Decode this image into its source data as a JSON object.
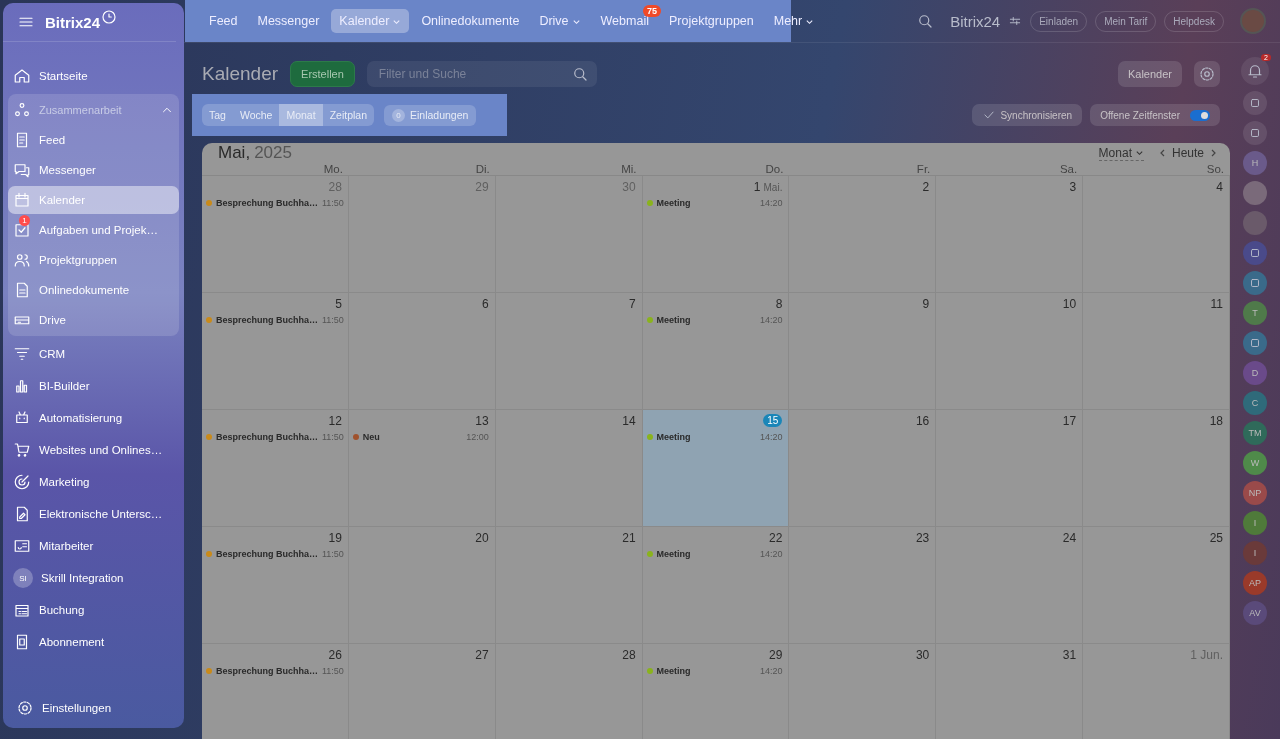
{
  "sidebar": {
    "logo": "Bitrix24",
    "items": [
      {
        "label": "Startseite",
        "kind": "link",
        "selected": false
      },
      {
        "label": "Zusammenarbeit",
        "kind": "group",
        "expanded": true,
        "children": [
          {
            "label": "Feed",
            "selected": false
          },
          {
            "label": "Messenger",
            "selected": false
          },
          {
            "label": "Kalender",
            "selected": true
          },
          {
            "label": "Aufgaben und Projek…",
            "selected": false,
            "badge": "1"
          },
          {
            "label": "Projektgruppen",
            "selected": false
          },
          {
            "label": "Onlinedokumente",
            "selected": false
          },
          {
            "label": "Drive",
            "selected": false
          }
        ]
      },
      {
        "label": "CRM",
        "kind": "link",
        "selected": false
      },
      {
        "label": "BI-Builder",
        "kind": "link",
        "selected": false
      },
      {
        "label": "Automatisierung",
        "kind": "link",
        "selected": false
      },
      {
        "label": "Websites und Onlines…",
        "kind": "link",
        "selected": false
      },
      {
        "label": "Marketing",
        "kind": "link",
        "selected": false
      },
      {
        "label": "Elektronische Untersc…",
        "kind": "link",
        "selected": false
      },
      {
        "label": "Mitarbeiter",
        "kind": "link",
        "selected": false
      },
      {
        "label": "Skrill Integration",
        "kind": "avatar",
        "initials": "SI",
        "selected": false
      },
      {
        "label": "Buchung",
        "kind": "link",
        "selected": false
      },
      {
        "label": "Abonnement",
        "kind": "link",
        "selected": false
      }
    ],
    "settings": "Einstellungen"
  },
  "topnav": {
    "items": [
      {
        "label": "Feed",
        "selected": false,
        "dropdown": false
      },
      {
        "label": "Messenger",
        "selected": false,
        "dropdown": false
      },
      {
        "label": "Kalender",
        "selected": true,
        "dropdown": true
      },
      {
        "label": "Onlinedokumente",
        "selected": false,
        "dropdown": false
      },
      {
        "label": "Drive",
        "selected": false,
        "dropdown": true
      },
      {
        "label": "Webmail",
        "selected": false,
        "dropdown": false,
        "badge": "75"
      },
      {
        "label": "Projektgruppen",
        "selected": false,
        "dropdown": false
      },
      {
        "label": "Mehr",
        "selected": false,
        "dropdown": true
      }
    ],
    "portal": "Bitrix24",
    "buttons": [
      "Einladen",
      "Mein Tarif",
      "Helpdesk"
    ]
  },
  "header": {
    "title": "Kalender",
    "create": "Erstellen",
    "search": {
      "placeholder": "Filter und Suche"
    },
    "calendar_button": "Kalender"
  },
  "views": [
    {
      "label": "Tag",
      "selected": false
    },
    {
      "label": "Woche",
      "selected": false
    },
    {
      "label": "Monat",
      "selected": true
    },
    {
      "label": "Zeitplan",
      "selected": false
    }
  ],
  "invitations": {
    "count": "0",
    "label": "Einladungen"
  },
  "sync": "Synchronisieren",
  "open_slots": {
    "label": "Offene Zeitfenster",
    "on": true
  },
  "calendar": {
    "month": "Mai,",
    "year": "2025",
    "mode": "Monat",
    "today": "Heute",
    "weekdays": [
      "Mo.",
      "Di.",
      "Mi.",
      "Do.",
      "Fr.",
      "Sa.",
      "So."
    ],
    "weeks": [
      [
        {
          "day": "28",
          "muted": true,
          "today": false,
          "events": [
            {
              "title": "Besprechung Buchha…",
              "time": "11:50",
              "color": "#c98a1a"
            }
          ]
        },
        {
          "day": "29",
          "muted": true,
          "today": false
        },
        {
          "day": "30",
          "muted": true,
          "today": false
        },
        {
          "day": "1",
          "month": "Mai.",
          "muted": false,
          "today": false,
          "events": [
            {
              "title": "Meeting",
              "time": "14:20",
              "color": "#8ab31c"
            }
          ]
        },
        {
          "day": "2",
          "muted": false,
          "today": false
        },
        {
          "day": "3",
          "muted": false,
          "today": false
        },
        {
          "day": "4",
          "muted": false,
          "today": false
        }
      ],
      [
        {
          "day": "5",
          "muted": false,
          "today": false,
          "events": [
            {
              "title": "Besprechung Buchha…",
              "time": "11:50",
              "color": "#c98a1a"
            }
          ]
        },
        {
          "day": "6",
          "muted": false,
          "today": false
        },
        {
          "day": "7",
          "muted": false,
          "today": false
        },
        {
          "day": "8",
          "muted": false,
          "today": false,
          "events": [
            {
              "title": "Meeting",
              "time": "14:20",
              "color": "#8ab31c"
            }
          ]
        },
        {
          "day": "9",
          "muted": false,
          "today": false
        },
        {
          "day": "10",
          "muted": false,
          "today": false
        },
        {
          "day": "11",
          "muted": false,
          "today": false
        }
      ],
      [
        {
          "day": "12",
          "muted": false,
          "today": false,
          "events": [
            {
              "title": "Besprechung Buchha…",
              "time": "11:50",
              "color": "#c98a1a"
            }
          ]
        },
        {
          "day": "13",
          "muted": false,
          "today": false,
          "events": [
            {
              "title": "Neu",
              "time": "12:00",
              "color": "#a0522d"
            }
          ]
        },
        {
          "day": "14",
          "muted": false,
          "today": false
        },
        {
          "day": "15",
          "muted": false,
          "today": true,
          "events": [
            {
              "title": "Meeting",
              "time": "14:20",
              "color": "#8ab31c"
            }
          ]
        },
        {
          "day": "16",
          "muted": false,
          "today": false
        },
        {
          "day": "17",
          "muted": false,
          "today": false
        },
        {
          "day": "18",
          "muted": false,
          "today": false
        }
      ],
      [
        {
          "day": "19",
          "muted": false,
          "today": false,
          "events": [
            {
              "title": "Besprechung Buchha…",
              "time": "11:50",
              "color": "#c98a1a"
            }
          ]
        },
        {
          "day": "20",
          "muted": false,
          "today": false
        },
        {
          "day": "21",
          "muted": false,
          "today": false
        },
        {
          "day": "22",
          "muted": false,
          "today": false,
          "events": [
            {
              "title": "Meeting",
              "time": "14:20",
              "color": "#8ab31c"
            }
          ]
        },
        {
          "day": "23",
          "muted": false,
          "today": false
        },
        {
          "day": "24",
          "muted": false,
          "today": false
        },
        {
          "day": "25",
          "muted": false,
          "today": false
        }
      ],
      [
        {
          "day": "26",
          "muted": false,
          "today": false,
          "events": [
            {
              "title": "Besprechung Buchha…",
              "time": "11:50",
              "color": "#c98a1a"
            }
          ]
        },
        {
          "day": "27",
          "muted": false,
          "today": false
        },
        {
          "day": "28",
          "muted": false,
          "today": false
        },
        {
          "day": "29",
          "muted": false,
          "today": false,
          "events": [
            {
              "title": "Meeting",
              "time": "14:20",
              "color": "#8ab31c"
            }
          ]
        },
        {
          "day": "30",
          "muted": false,
          "today": false
        },
        {
          "day": "31",
          "muted": false,
          "today": false
        },
        {
          "day": "1 Jun.",
          "muted": true,
          "today": false
        }
      ]
    ]
  },
  "rail": [
    {
      "kind": "bell",
      "badge": "2"
    },
    {
      "kind": "icon"
    },
    {
      "kind": "icon"
    },
    {
      "kind": "initials",
      "text": "H",
      "color": "#6a5a8a"
    },
    {
      "kind": "photo",
      "color": "#7a6a7a"
    },
    {
      "kind": "photo",
      "color": "#6a5a6a"
    },
    {
      "kind": "icon",
      "color": "#4a4a8a"
    },
    {
      "kind": "icon",
      "color": "#3a6a8a"
    },
    {
      "kind": "initials",
      "text": "T",
      "color": "#4f7a4a"
    },
    {
      "kind": "icon",
      "color": "#3a6a8a"
    },
    {
      "kind": "initials",
      "text": "D",
      "color": "#6a4a8a"
    },
    {
      "kind": "initials",
      "text": "C",
      "color": "#2f6a7a"
    },
    {
      "kind": "initials",
      "text": "TM",
      "color": "#2f6a5a"
    },
    {
      "kind": "initials",
      "text": "W",
      "color": "#4f8a4a"
    },
    {
      "kind": "initials",
      "text": "NP",
      "color": "#9a4a4a"
    },
    {
      "kind": "initials",
      "text": "I",
      "color": "#4f7a3a"
    },
    {
      "kind": "initials",
      "text": "I",
      "color": "#6a3a3a"
    },
    {
      "kind": "initials",
      "text": "AP",
      "color": "#9a3a2a"
    },
    {
      "kind": "initials",
      "text": "AV",
      "color": "#5a4a7a"
    }
  ]
}
